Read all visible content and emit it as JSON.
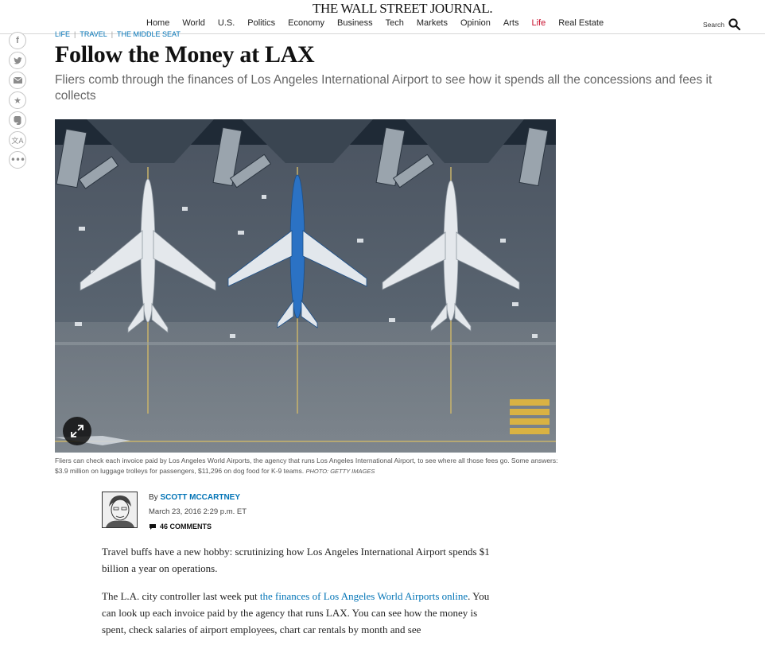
{
  "masthead": {
    "logo": "THE WALL STREET JOURNAL.",
    "nav": [
      "Home",
      "World",
      "U.S.",
      "Politics",
      "Economy",
      "Business",
      "Tech",
      "Markets",
      "Opinion",
      "Arts",
      "Life",
      "Real Estate"
    ],
    "active_nav": "Life",
    "search_label": "Search",
    "accent_color": "#c8102e"
  },
  "social": [
    "facebook-icon",
    "twitter-icon",
    "email-icon",
    "bookmark-icon",
    "evernote-icon",
    "translate-icon",
    "more-icon"
  ],
  "breadcrumb": [
    "LIFE",
    "TRAVEL",
    "THE MIDDLE SEAT"
  ],
  "article": {
    "headline": "Follow the Money at LAX",
    "dek": "Fliers comb through the finances of Los Angeles International Airport to see how it spends all the concessions and fees it collects",
    "caption": "Fliers can check each invoice paid by Los Angeles World Airports, the agency that runs Los Angeles International Airport, to see where all those fees go. Some answers: $3.9 million on luggage trolleys for passengers, $11,296 on dog food for K-9 teams.",
    "photo_credit": "PHOTO: GETTY IMAGES",
    "byline_prefix": "By",
    "author": "SCOTT MCCARTNEY",
    "date": "March 23, 2016 2:29 p.m. ET",
    "comments": "46 COMMENTS",
    "para1": "Travel buffs have a new hobby: scrutinizing how Los Angeles International Airport spends $1 billion a year on operations.",
    "para2_before": "The L.A. city controller last week put ",
    "para2_link": "the finances of Los Angeles World Airports online",
    "para2_after": ". You can look up each invoice paid by the agency that runs LAX. You can see how the money is spent, check salaries of airport employees, chart car rentals by month and see"
  },
  "colors": {
    "link": "#0274b6",
    "headline": "#111111",
    "dek": "#666666"
  }
}
